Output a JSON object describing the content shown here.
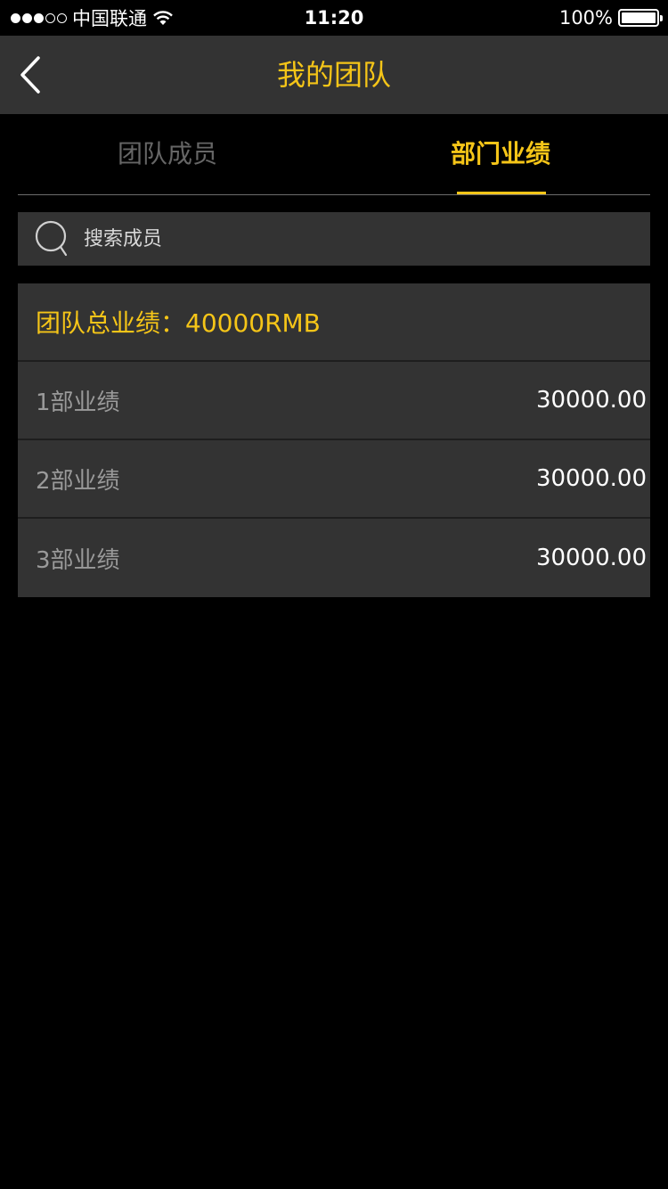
{
  "status_bar": {
    "carrier": "中国联通",
    "time": "11:20",
    "battery": "100%"
  },
  "nav": {
    "title": "我的团队",
    "back_icon": "chevron-left-icon"
  },
  "tabs": [
    {
      "label": "团队成员",
      "active": false
    },
    {
      "label": "部门业绩",
      "active": true
    }
  ],
  "search": {
    "placeholder": "搜索成员",
    "icon": "search-icon"
  },
  "summary": {
    "label": "团队总业绩：40000RMB"
  },
  "departments": [
    {
      "label": "1部业绩",
      "value": "30000.00"
    },
    {
      "label": "2部业绩",
      "value": "30000.00"
    },
    {
      "label": "3部业绩",
      "value": "30000.00"
    }
  ],
  "colors": {
    "accent": "#F5C518",
    "panel": "#333333",
    "background": "#000000"
  }
}
